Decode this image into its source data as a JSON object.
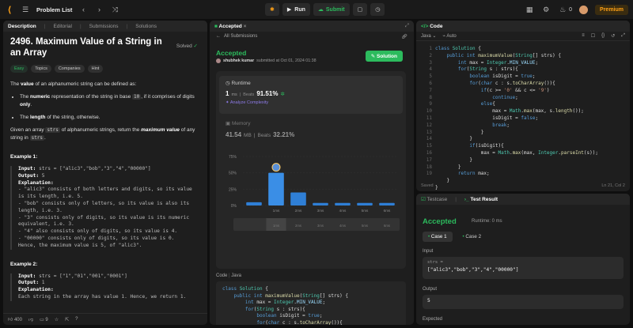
{
  "topbar": {
    "problem_list": "Problem List",
    "run": "Run",
    "submit": "Submit",
    "streak": "0",
    "premium": "Premium"
  },
  "left": {
    "tabs": [
      "Description",
      "Editorial",
      "Submissions",
      "Solutions"
    ],
    "title": "2496. Maximum Value of a String in an Array",
    "solved": "Solved",
    "tags": [
      "Easy",
      "Topics",
      "Companies",
      "Hint"
    ],
    "intro_value": "value",
    "intro_rest": " of an alphanumeric string can be defined as:",
    "intro_the": "The ",
    "b1_pre": "The ",
    "b1_bold": "numeric",
    "b1_mid": " representation of the string in base ",
    "b1_code": "10",
    "b1_post": ", if it comprises of digits ",
    "b1_only": "only",
    "b2_pre": "The ",
    "b2_bold": "length",
    "b2_post": " of the string, otherwise.",
    "p2_pre": "Given an array ",
    "p2_code1": "strs",
    "p2_mid": " of alphanumeric strings, return the ",
    "p2_bold": "maximum value",
    "p2_post": " of any string in ",
    "p2_code2": "strs",
    "ex1_head": "Example 1:",
    "ex1_input_label": "Input:",
    "ex1_input": " strs = [\"alic3\",\"bob\",\"3\",\"4\",\"00000\"]",
    "ex1_output_label": "Output:",
    "ex1_output": " 5",
    "ex1_expl_label": "Explanation:",
    "ex1_expl": "- \"alic3\" consists of both letters and digits, so its value is its length, i.e. 5.\n- \"bob\" consists only of letters, so its value is also its length, i.e. 3.\n- \"3\" consists only of digits, so its value is its numeric equivalent, i.e. 3.\n- \"4\" also consists only of digits, so its value is 4.\n- \"00000\" consists only of digits, so its value is 0.\nHence, the maximum value is 5, of \"alic3\".",
    "ex2_head": "Example 2:",
    "ex2_input_label": "Input:",
    "ex2_input": " strs = [\"1\",\"01\",\"001\",\"0001\"]",
    "ex2_output_label": "Output:",
    "ex2_output": " 1",
    "ex2_expl_label": "Explanation:",
    "ex2_expl": "Each string in the array has value 1. Hence, we return 1.",
    "likes": "400",
    "comments": "9"
  },
  "mid": {
    "tab": "Accepted",
    "back": "All Submissions",
    "status": "Accepted",
    "user": "shubhek kumar",
    "submitted": "submitted at Oct 01, 2024 01:38",
    "solution_btn": "Solution",
    "runtime_label": "Runtime",
    "runtime_value": "1",
    "runtime_unit": "ms",
    "beats_label": "Beats",
    "runtime_beats": "91.51%",
    "analyze": "Analyze Complexity",
    "memory_label": "Memory",
    "memory_value": "41.54",
    "memory_unit": "MB",
    "memory_beats": "32.21%",
    "code_label": "Code",
    "code_lang": "Java"
  },
  "chart_data": {
    "type": "bar",
    "categories": [
      "",
      "1ms",
      "2ms",
      "3ms",
      "4ms",
      "5ms",
      "6ms"
    ],
    "values": [
      5,
      50,
      20,
      4,
      4,
      4,
      4
    ],
    "yticks": [
      "75%",
      "50%",
      "25%",
      "0%"
    ],
    "ylim": [
      0,
      75
    ],
    "highlight": "1ms",
    "colors": {
      "bar": "#2f7fd6",
      "highlight": "#3a8ee6"
    }
  },
  "editor": {
    "tab": "Code",
    "lang": "Java",
    "auto": "Auto",
    "saved": "Saved",
    "cursor": "Ln 21, Col 2"
  },
  "result": {
    "tab_testcase": "Testcase",
    "tab_result": "Test Result",
    "status": "Accepted",
    "runtime": "Runtime: 0 ms",
    "case1": "Case 1",
    "case2": "Case 2",
    "input_label": "Input",
    "input_var": "strs =",
    "input_value": "[\"alic3\",\"bob\",\"3\",\"4\",\"00000\"]",
    "output_label": "Output",
    "output_value": "5",
    "expected_label": "Expected"
  }
}
